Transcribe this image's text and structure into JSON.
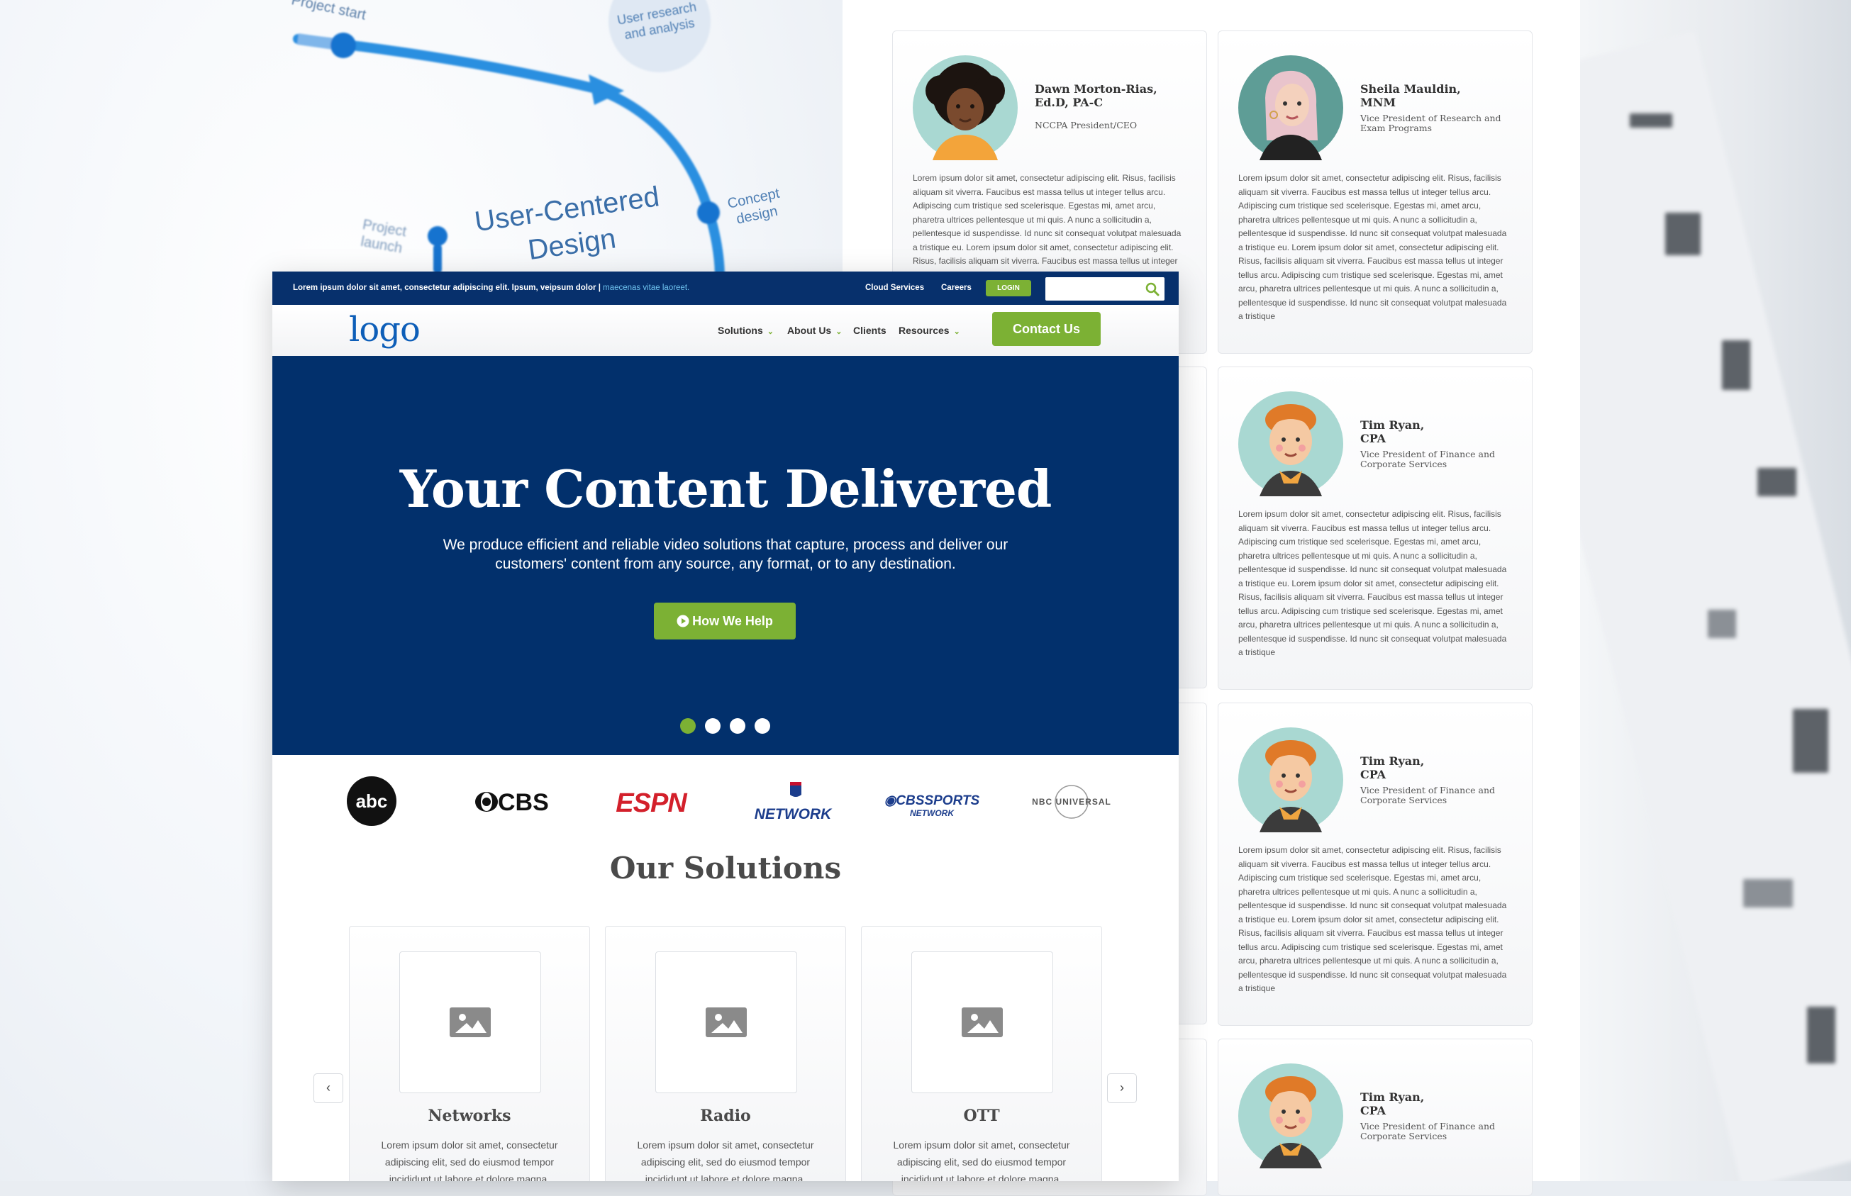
{
  "background_diagram": {
    "title": "User-Centered Design",
    "labels": {
      "project_start": "Project start",
      "user_research": "User research and analysis",
      "concept_design": "Concept design",
      "project_launch": "Project launch"
    }
  },
  "team": [
    {
      "name": "Dawn Morton-Rias,\nEd.D, PA-C",
      "role": "NCCPA President/CEO",
      "bio": "Lorem ipsum dolor sit amet, consectetur adipiscing elit. Risus, facilisis aliquam sit viverra. Faucibus est massa tellus ut integer tellus arcu. Adipiscing cum tristique sed scelerisque. Egestas mi, amet arcu, pharetra ultrices pellentesque ut mi quis. A nunc a sollicitudin a, pellentesque id suspendisse. Id nunc sit consequat volutpat malesuada a tristique eu. Lorem ipsum dolor sit amet, consectetur adipiscing elit. Risus, facilisis aliquam sit viverra. Faucibus est massa tellus ut integer tellus arcu."
    },
    {
      "name": "Sheila Mauldin,\nMNM",
      "role": "Vice President of Research and Exam Programs",
      "bio": "Lorem ipsum dolor sit amet, consectetur adipiscing elit. Risus, facilisis aliquam sit viverra. Faucibus est massa tellus ut integer tellus arcu. Adipiscing cum tristique sed scelerisque. Egestas mi, amet arcu, pharetra ultrices pellentesque ut mi quis. A nunc a sollicitudin a, pellentesque id suspendisse. Id nunc sit consequat volutpat malesuada a tristique eu. Lorem ipsum dolor sit amet, consectetur adipiscing elit. Risus, facilisis aliquam sit viverra. Faucibus est massa tellus ut integer tellus arcu. Adipiscing cum tristique sed scelerisque. Egestas mi, amet arcu, pharetra ultrices pellentesque ut mi quis. A nunc a sollicitudin a, pellentesque id suspendisse. Id nunc sit consequat volutpat malesuada a tristique"
    },
    {
      "name": "Tim Ryan,\nCPA",
      "role": "Vice President of Finance and Corporate Services",
      "bio": "Lorem ipsum dolor sit amet, consectetur adipiscing elit. Risus, facilisis aliquam sit viverra. Faucibus est massa tellus ut integer tellus arcu. Adipiscing cum tristique sed scelerisque. Egestas mi, amet arcu, pharetra ultrices pellentesque ut mi quis. A nunc a sollicitudin a, pellentesque id suspendisse. Id nunc sit consequat volutpat malesuada a tristique eu. Lorem ipsum dolor sit amet, consectetur adipiscing elit. Risus, facilisis aliquam sit viverra. Faucibus est massa tellus ut integer tellus arcu. Adipiscing cum tristique sed scelerisque. Egestas mi, amet arcu, pharetra ultrices pellentesque ut mi quis. A nunc a sollicitudin a, pellentesque id suspendisse. Id nunc sit consequat volutpat malesuada a tristique"
    },
    {
      "name": "Tim Ryan,\nCPA",
      "role": "Vice President of Finance and Corporate Services",
      "bio": "Lorem ipsum dolor sit amet, consectetur adipiscing elit. Risus, facilisis aliquam sit viverra. Faucibus est massa tellus ut integer tellus arcu. Adipiscing cum tristique sed scelerisque. Egestas mi, amet arcu, pharetra ultrices pellentesque ut mi quis. A nunc a sollicitudin a, pellentesque id suspendisse. Id nunc sit consequat volutpat malesuada a tristique eu. Lorem ipsum dolor sit amet, consectetur adipiscing elit. Risus, facilisis aliquam sit viverra. Faucibus est massa tellus ut integer tellus arcu. Adipiscing cum tristique sed scelerisque. Egestas mi, amet arcu, pharetra ultrices pellentesque ut mi quis. A nunc a sollicitudin a, pellentesque id suspendisse. Id nunc sit consequat volutpat malesuada a tristique"
    },
    {
      "name": "Tim Ryan,\nCPA",
      "role": "Vice President of Finance and Corporate Services",
      "bio": ""
    }
  ],
  "site": {
    "topbar": {
      "message": "Lorem ipsum dolor sit amet, consectetur adipiscing elit. Ipsum, veipsum dolor |",
      "message_link": "maecenas vitae laoreet.",
      "cloud_services": "Cloud Services",
      "careers": "Careers",
      "login": "LOGIN",
      "search_placeholder": ""
    },
    "nav": {
      "logo": "logo",
      "items": [
        "Solutions",
        "About Us",
        "Clients",
        "Resources"
      ],
      "contact": "Contact Us"
    },
    "hero": {
      "title": "Your Content Delivered",
      "subtitle": "We produce efficient and reliable video solutions that capture, process and deliver our customers' content from any source, any format, or to any destination.",
      "button": "How We Help",
      "slides": 4,
      "active_slide": 1
    },
    "client_logos": [
      "abc",
      "CBS",
      "ESPN",
      "NFL NETWORK",
      "CBS SPORTS NETWORK",
      "NBC UNIVERSAL"
    ],
    "solutions": {
      "title": "Our Solutions",
      "cards": [
        {
          "title": "Networks",
          "desc": "Lorem ipsum dolor sit amet, consectetur adipiscing elit, sed do eiusmod tempor incididunt ut labore et dolore magna."
        },
        {
          "title": "Radio",
          "desc": "Lorem ipsum dolor sit amet, consectetur adipiscing elit, sed do eiusmod tempor incididunt ut labore et dolore magna."
        },
        {
          "title": "OTT",
          "desc": "Lorem ipsum dolor sit amet, consectetur adipiscing elit, sed do eiusmod tempor incididunt ut labore et dolore magna."
        }
      ]
    }
  },
  "colors": {
    "navy": "#07306c",
    "green": "#7cb134",
    "logo_blue": "#0d5eb8"
  }
}
